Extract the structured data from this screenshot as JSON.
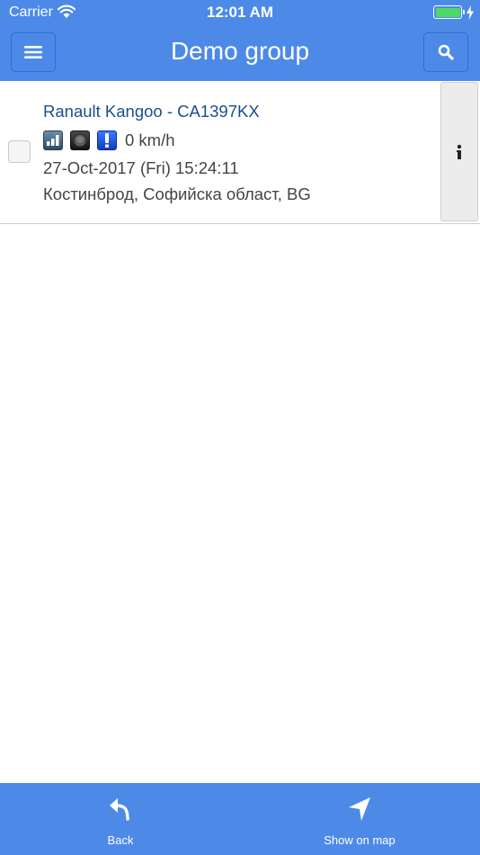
{
  "status_bar": {
    "carrier": "Carrier",
    "time": "12:01 AM",
    "battery_color": "#4cd964"
  },
  "nav": {
    "title": "Demo group",
    "left_icon": "hamburger-menu-icon",
    "right_icon": "search-icon",
    "bar_color": "#4d8ae8"
  },
  "vehicles": [
    {
      "name": "Ranault Kangoo - CA1397KX",
      "status_icons": [
        "signal-strength-icon",
        "ignition-off-icon",
        "alarm-exclamation-icon"
      ],
      "speed": "0 km/h",
      "timestamp": "27-Oct-2017 (Fri) 15:24:11",
      "location": "Костинброд, Софийска област, BG",
      "selected": false
    }
  ],
  "bottom_bar": {
    "back_label": "Back",
    "map_label": "Show on map"
  }
}
